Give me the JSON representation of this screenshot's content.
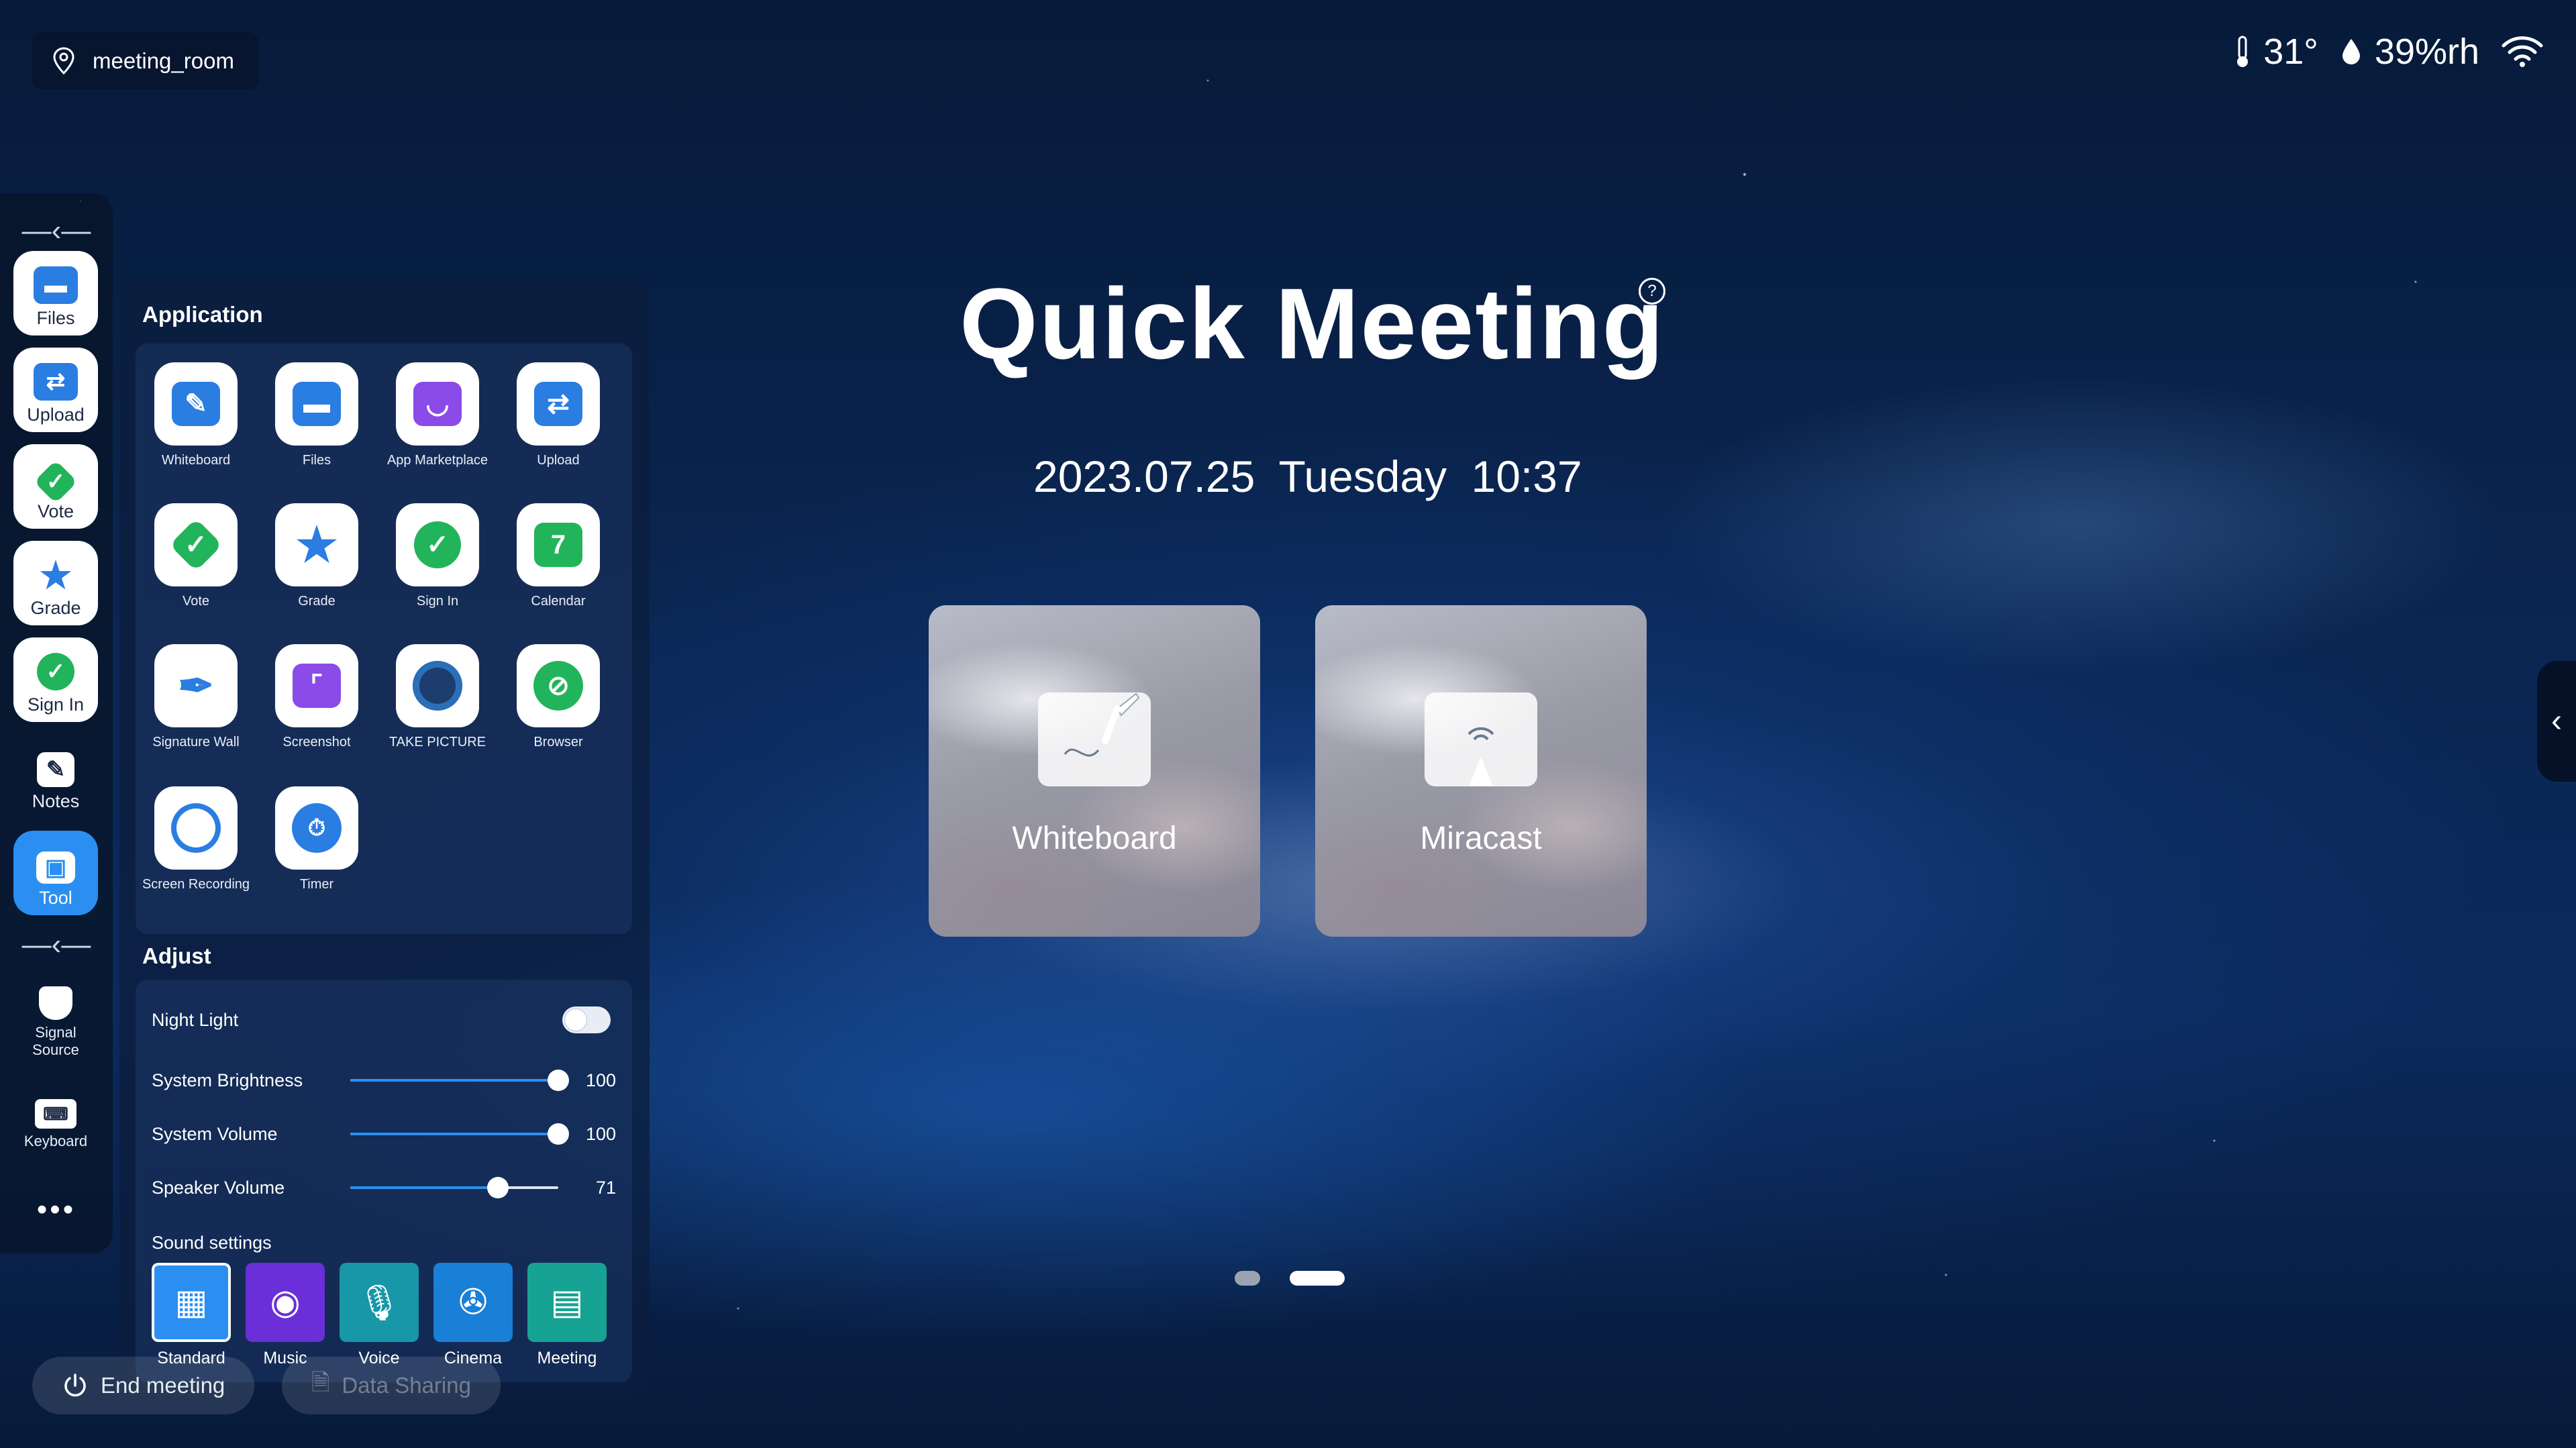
{
  "top": {
    "location": "meeting_room",
    "temperature": "31°",
    "humidity": "39%rh"
  },
  "dock": {
    "items": [
      {
        "label": "Files",
        "color": "#2a7de1"
      },
      {
        "label": "Upload",
        "color": "#2a7de1"
      },
      {
        "label": "Vote",
        "color": "#22b45a"
      },
      {
        "label": "Grade",
        "color": "#2a7de1"
      },
      {
        "label": "Sign In",
        "color": "#22b45a"
      },
      {
        "label": "Notes",
        "color": "#ffffff"
      },
      {
        "label": "Tool",
        "color": "#ffffff"
      },
      {
        "label": "Signal\nSource",
        "color": "#ffffff"
      },
      {
        "label": "Keyboard",
        "color": "#ffffff"
      }
    ],
    "more": "•••"
  },
  "panel": {
    "application_title": "Application",
    "apps": [
      {
        "label": "Whiteboard",
        "color": "#2a7de1"
      },
      {
        "label": "Files",
        "color": "#2a7de1"
      },
      {
        "label": "App Marketplace",
        "color": "#8a4be8"
      },
      {
        "label": "Upload",
        "color": "#2a7de1"
      },
      {
        "label": "Vote",
        "color": "#22b45a"
      },
      {
        "label": "Grade",
        "color": "#2a7de1"
      },
      {
        "label": "Sign In",
        "color": "#22b45a"
      },
      {
        "label": "Calendar",
        "color": "#22b45a"
      },
      {
        "label": "Signature Wall",
        "color": "#2a7de1"
      },
      {
        "label": "Screenshot",
        "color": "#8a4be8"
      },
      {
        "label": "TAKE PICTURE",
        "color": "#1c3d6e"
      },
      {
        "label": "Browser",
        "color": "#22b45a"
      },
      {
        "label": "Screen Recording",
        "color": "#2a7de1"
      },
      {
        "label": "Timer",
        "color": "#2a7de1"
      }
    ],
    "adjust_title": "Adjust",
    "night_light": "Night Light",
    "sliders": [
      {
        "label": "System Brightness",
        "value": 100
      },
      {
        "label": "System Volume",
        "value": 100
      },
      {
        "label": "Speaker Volume",
        "value": 71
      }
    ],
    "sound_title": "Sound settings",
    "sound_modes": [
      {
        "label": "Standard",
        "color": "#2a8ff0"
      },
      {
        "label": "Music",
        "color": "#6a2fd8"
      },
      {
        "label": "Voice",
        "color": "#1797a8"
      },
      {
        "label": "Cinema",
        "color": "#1a7fd6"
      },
      {
        "label": "Meeting",
        "color": "#16a394"
      }
    ]
  },
  "bottom": {
    "end_meeting": "End meeting",
    "data_sharing": "Data Sharing"
  },
  "main": {
    "title": "Quick Meeting",
    "datetime": "2023.07.25 Tuesday 10:37",
    "cards": [
      {
        "label": "Whiteboard"
      },
      {
        "label": "Miracast"
      }
    ]
  }
}
